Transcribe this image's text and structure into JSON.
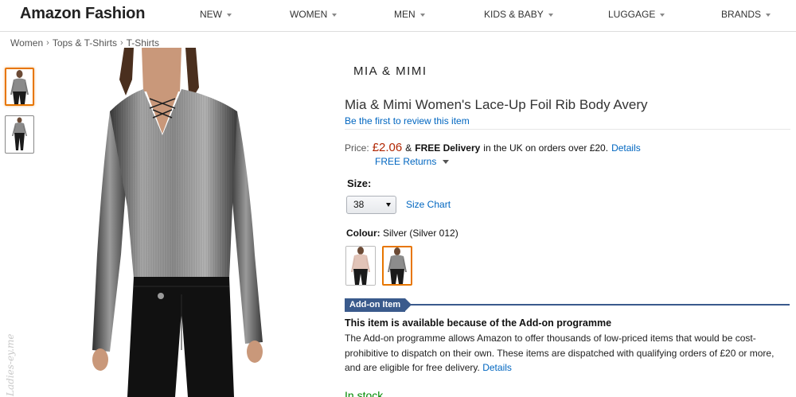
{
  "header": {
    "logo": "Amazon Fashion",
    "nav": [
      {
        "label": "NEW"
      },
      {
        "label": "WOMEN"
      },
      {
        "label": "MEN"
      },
      {
        "label": "KIDS & BABY"
      },
      {
        "label": "LUGGAGE"
      },
      {
        "label": "BRANDS"
      }
    ]
  },
  "breadcrumb": [
    "Women",
    "Tops & T-Shirts",
    "T-Shirts"
  ],
  "gallery": {
    "thumbnails": [
      {
        "alt": "front-view",
        "selected": true
      },
      {
        "alt": "full-outfit-view",
        "selected": false
      }
    ],
    "watermark": "Ladies-ey.me"
  },
  "product": {
    "brand_logo": "MIA & MIMI",
    "title": "Mia & Mimi Women's Lace-Up Foil Rib Body Avery",
    "review_link": "Be the first to review this item",
    "price": {
      "label": "Price:",
      "value": "£2.06",
      "conj": "&",
      "free_delivery": "FREE Delivery",
      "delivery_text": "in the UK on orders over £20.",
      "details": "Details",
      "returns": "FREE Returns"
    },
    "size": {
      "label": "Size:",
      "selected": "38",
      "chart_link": "Size Chart"
    },
    "colour": {
      "label": "Colour:",
      "value": "Silver (Silver 012)",
      "swatches": [
        {
          "name": "pink-variant",
          "selected": false
        },
        {
          "name": "silver-variant",
          "selected": true
        }
      ]
    },
    "addon": {
      "badge": "Add-on Item",
      "title": "This item is available because of the Add-on programme",
      "text": "The Add-on programme allows Amazon to offer thousands of low-priced items that would be cost-prohibitive to dispatch on their own. These items are dispatched with qualifying orders of £20 or more, and are eligible for free delivery.",
      "details": "Details"
    },
    "stock": "In stock."
  },
  "colors": {
    "link": "#0066c0",
    "price": "#b12704",
    "selected_border": "#e77600",
    "addon": "#3a5a8c"
  }
}
